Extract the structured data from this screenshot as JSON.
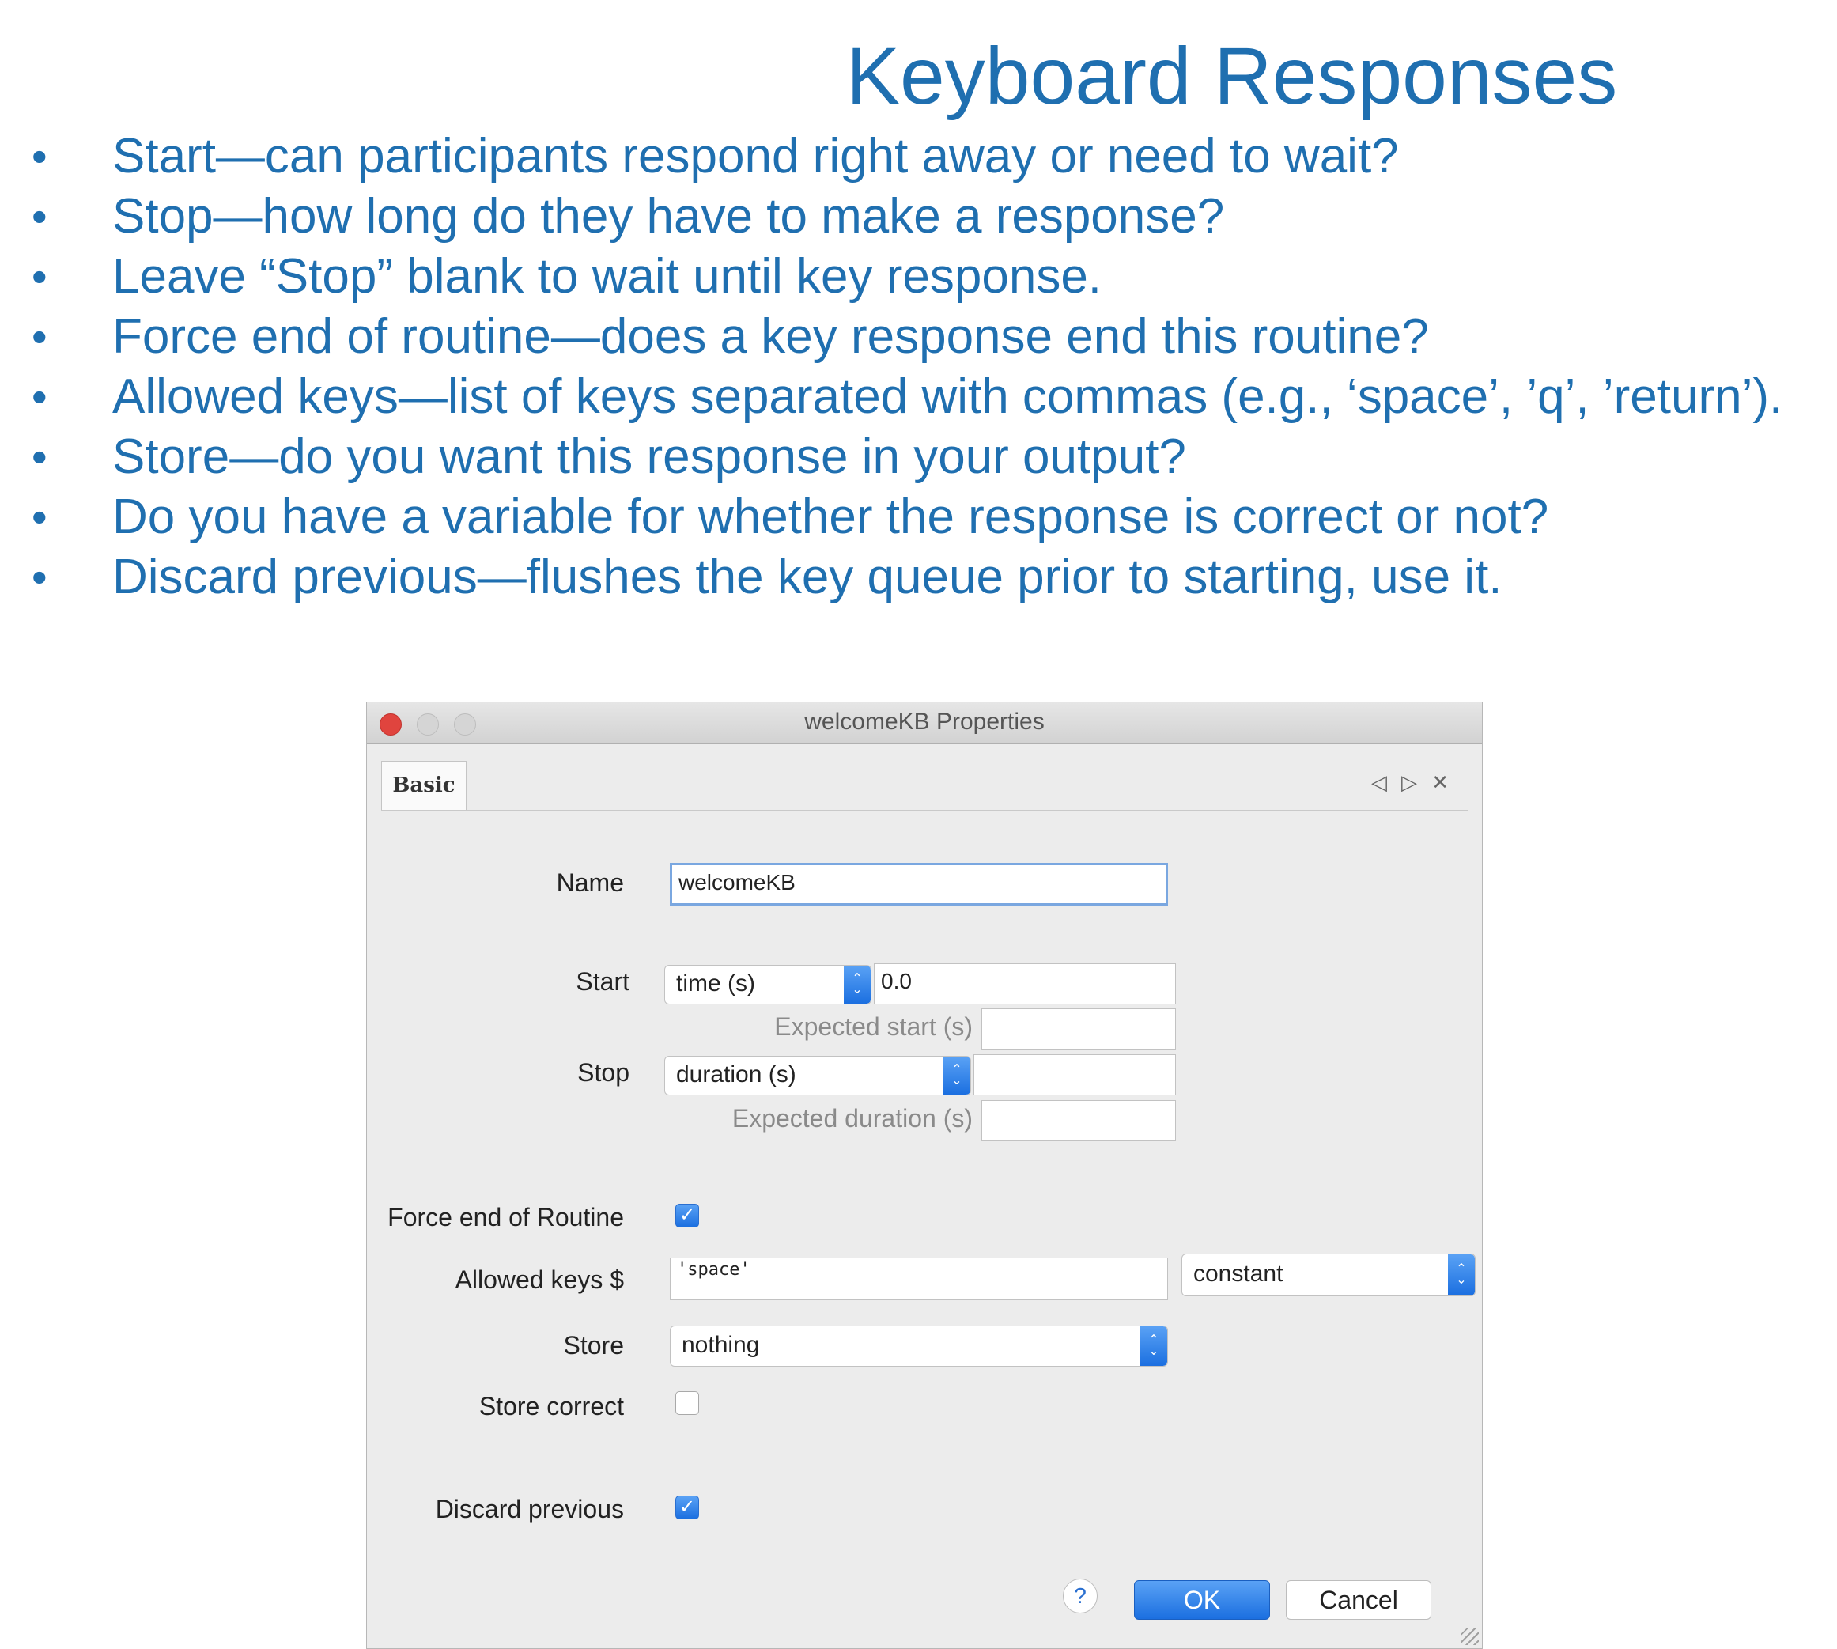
{
  "slide": {
    "title": "Keyboard Responses",
    "bullet_char": "•",
    "bullets": [
      "Start—can participants respond right away or need to wait?",
      "Stop—how long do they have to make a response?",
      "Leave “Stop” blank to wait until key response.",
      "Force end of routine—does a key response end this routine?",
      "Allowed keys—list of keys separated with commas (e.g., ‘space’, ’q’, ’return’).",
      "Store—do you want this response in your output?",
      "Do you have a variable for whether the response is correct or not?",
      "Discard previous—flushes the key queue prior to starting, use it."
    ]
  },
  "dialog": {
    "window_title": "welcomeKB Properties",
    "tab_label": "Basic",
    "tab_nav": {
      "prev": "◁",
      "next": "▷",
      "close": "✕"
    },
    "name": {
      "label": "Name",
      "value": "welcomeKB"
    },
    "start": {
      "label": "Start",
      "type": "time (s)",
      "value": "0.0",
      "expected_label": "Expected start (s)",
      "expected_value": ""
    },
    "stop": {
      "label": "Stop",
      "type": "duration (s)",
      "value": "",
      "expected_label": "Expected duration (s)",
      "expected_value": ""
    },
    "force_end": {
      "label": "Force end of Routine",
      "checked": true
    },
    "allowed_keys": {
      "label": "Allowed keys $",
      "value": "'space'",
      "mode": "constant"
    },
    "store": {
      "label": "Store",
      "value": "nothing"
    },
    "store_correct": {
      "label": "Store correct",
      "checked": false
    },
    "discard_previous": {
      "label": "Discard previous",
      "checked": true
    },
    "help_label": "?",
    "ok_label": "OK",
    "cancel_label": "Cancel",
    "checkmark": "✓",
    "stepper_up": "⌃",
    "stepper_down": "⌄"
  },
  "colors": {
    "slide_text": "#1f6fb0",
    "accent_blue": "#1b6fe0",
    "close_red": "#e0443e"
  }
}
